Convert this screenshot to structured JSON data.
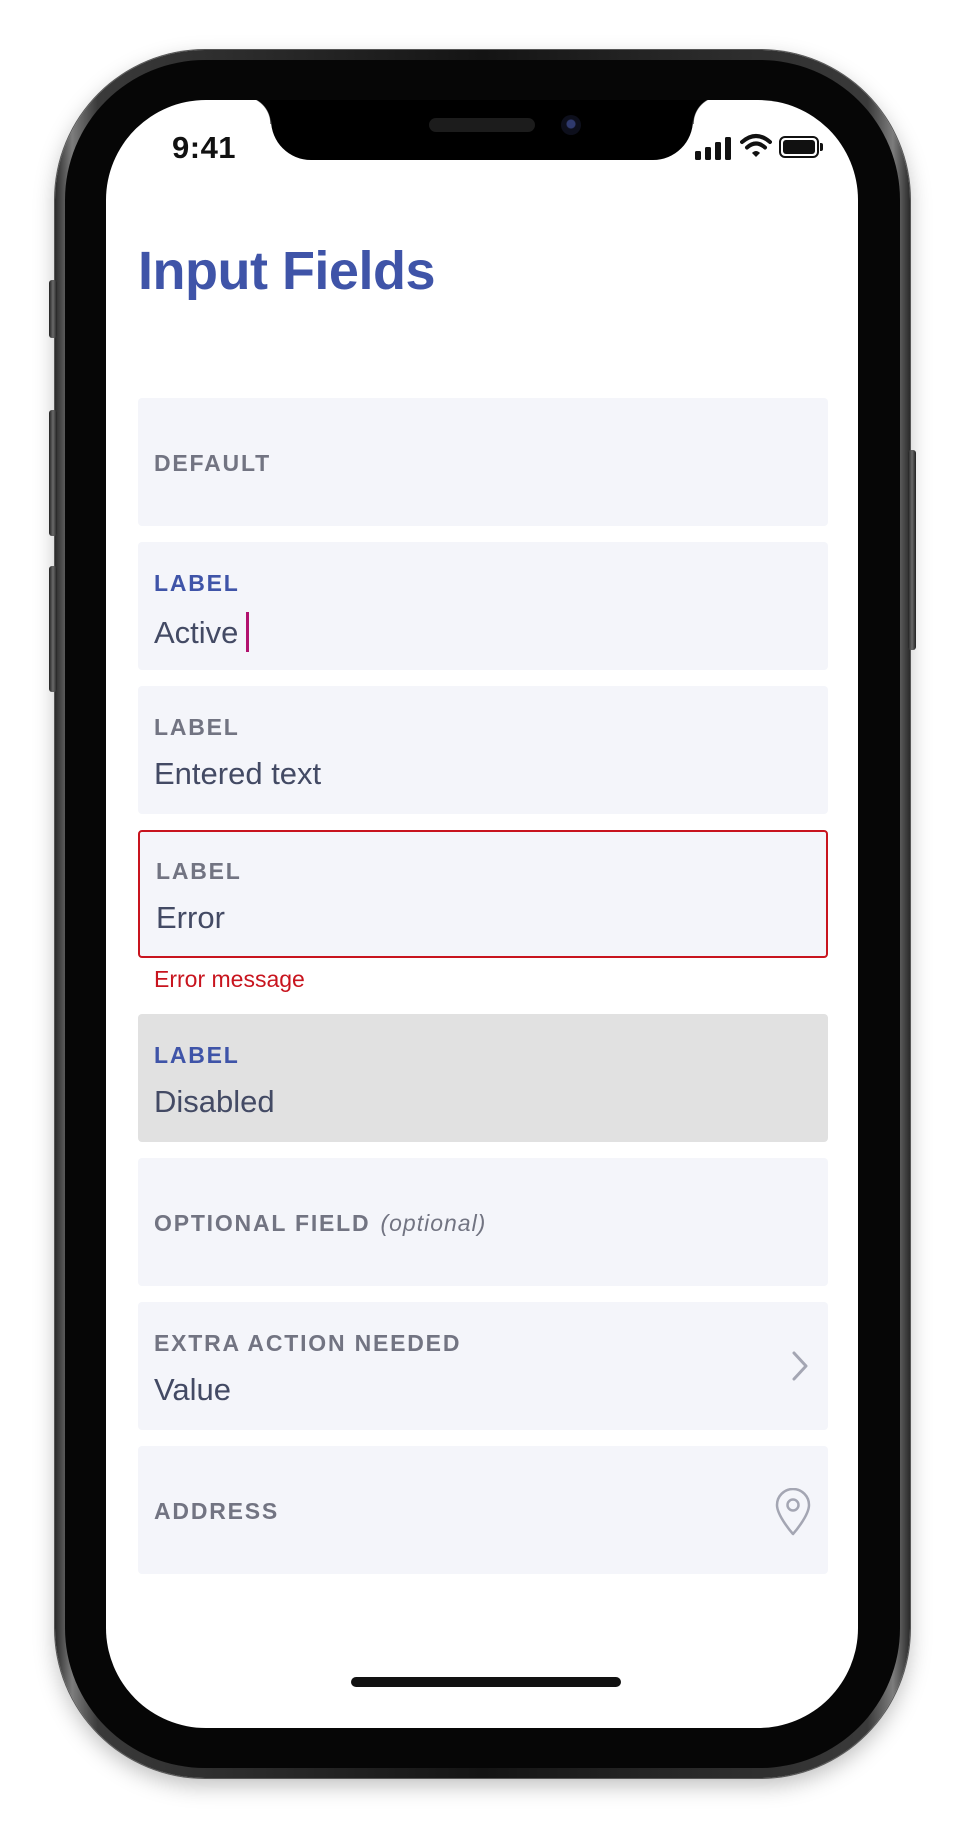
{
  "status_bar": {
    "time": "9:41"
  },
  "page": {
    "title": "Input Fields"
  },
  "fields": [
    {
      "label": "DEFAULT",
      "value": ""
    },
    {
      "label": "LABEL",
      "value": "Active"
    },
    {
      "label": "LABEL",
      "value": "Entered text"
    },
    {
      "label": "LABEL",
      "value": "Error",
      "error_message": "Error message"
    },
    {
      "label": "LABEL",
      "value": "Disabled"
    },
    {
      "label": "OPTIONAL FIELD",
      "optional_note": "(optional)",
      "value": ""
    },
    {
      "label": "EXTRA ACTION NEEDED",
      "value": "Value",
      "icon": "chevron-right-icon"
    },
    {
      "label": "ADDRESS",
      "value": "",
      "icon": "location-pin-icon"
    }
  ],
  "colors": {
    "accent": "#3f54a8",
    "error": "#c8141e",
    "cursor": "#b2126e",
    "field_background": "#f4f5fa",
    "disabled_background": "#e1e1e1"
  }
}
